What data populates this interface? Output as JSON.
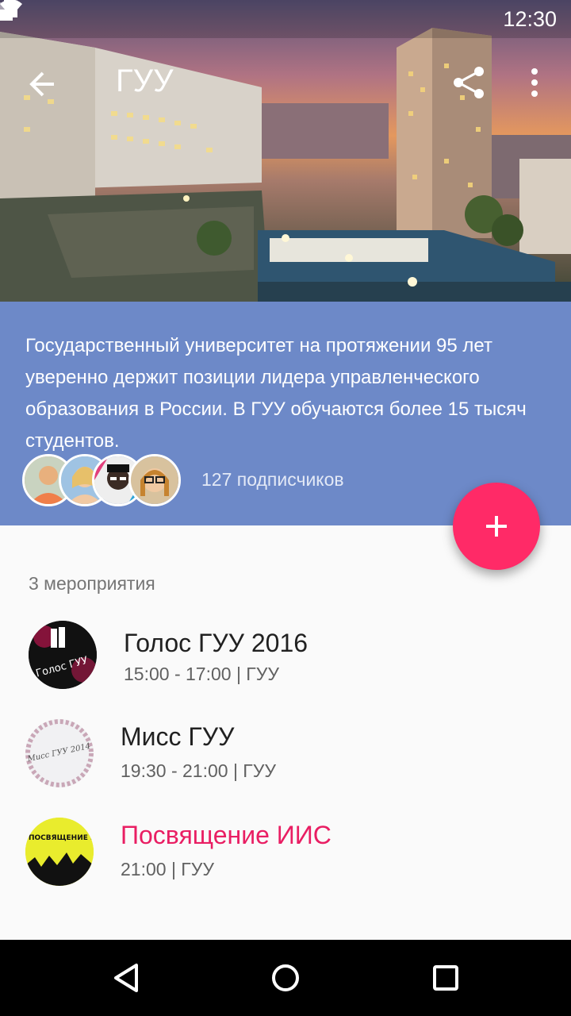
{
  "status_bar": {
    "time": "12:30",
    "icons": [
      "wifi-icon",
      "signal-icon",
      "battery-icon"
    ]
  },
  "toolbar": {
    "title": "ГУУ",
    "icons": [
      "arrow-back-icon",
      "share-icon",
      "more-vert-icon"
    ]
  },
  "info": {
    "description": "Государственный университет на протяжении 95 лет уверенно держит позиции лидера управленческого образования в России. В ГУУ обучаются более 15 тысяч студентов.",
    "subscribers": "127 подписчиков",
    "background_color": "#6d89c8"
  },
  "fab": {
    "icon": "plus-icon",
    "color": "#ff2a67"
  },
  "events": {
    "count_label": "3 мероприятия",
    "items": [
      {
        "title": "Голос ГУУ 2016",
        "meta": "15:00 - 17:00  | ГУУ",
        "thumb_text": "Голос ГУУ"
      },
      {
        "title": "Мисс ГУУ",
        "meta": "19:30 - 21:00  |  ГУУ",
        "thumb_text": "Мисс ГУУ 2014"
      },
      {
        "title": "Посвящение ИИС",
        "meta": "21:00  |  ГУУ",
        "thumb_text": "ПОСВЯЩЕНИЕ ИИС",
        "highlight_color": "#e91e63"
      }
    ]
  },
  "navbar": {
    "icons": [
      "back-triangle-icon",
      "home-circle-icon",
      "recents-square-icon"
    ]
  }
}
